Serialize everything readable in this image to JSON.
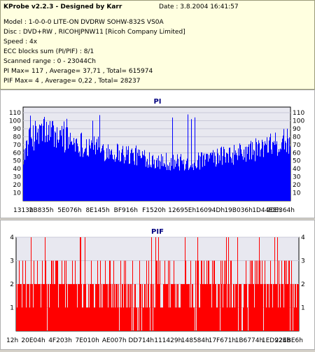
{
  "header": {
    "title": "KProbe v2.2.3 - Designed by Karr",
    "date": "Date : 3.8.2004 16:41:57"
  },
  "info": {
    "model": "Model : 1-0-0-0 LITE-ON DVDRW SOHW-832S  VS0A",
    "disc": "Disc : DVD+RW , RICOHJPNW11 [Ricoh Company Limited]",
    "speed": "Speed : 4x",
    "ecc": "ECC blocks sum (PI/PIF) : 8/1",
    "range": "Scanned range : 0 - 23044Ch",
    "pi": "PI Max= 117 , Average= 37,71 , Total= 615974",
    "pif": "PIF Max= 4 , Average= 0,22 , Total= 28237"
  },
  "colors": {
    "pi": "#0000ff",
    "pif": "#ff0000",
    "plot_bg": "#e8e8f0",
    "title_text": "#000080"
  },
  "chart_data": [
    {
      "type": "bar",
      "title": "PI",
      "ylim": [
        0,
        117
      ],
      "yticks": [
        10,
        20,
        30,
        40,
        50,
        60,
        70,
        80,
        90,
        100,
        110
      ],
      "xticks": [
        "1313h",
        "2B835h",
        "5E076h",
        "8E145h",
        "BF916h",
        "F1520h",
        "12695Eh",
        "16094Dh",
        "19B036h",
        "1D44EEh",
        "20E364h"
      ],
      "profile_x": [
        0,
        0.03,
        0.08,
        0.15,
        0.25,
        0.35,
        0.45,
        0.55,
        0.62,
        0.7,
        0.8,
        0.88,
        0.95,
        1.0
      ],
      "profile_y": [
        60,
        82,
        90,
        80,
        70,
        62,
        56,
        50,
        48,
        54,
        60,
        66,
        72,
        78
      ],
      "spike_to": 110,
      "grid": true
    },
    {
      "type": "bar",
      "title": "PIF",
      "ylim": [
        0,
        4
      ],
      "yticks": [
        1,
        2,
        3,
        4
      ],
      "xticks": [
        "12h",
        "20E04h",
        "4F203h",
        "7E010h",
        "AE007h",
        "DD714h",
        "111429h",
        "148584h",
        "17F671h",
        "1B6774h",
        "1ED92Eh",
        "224BE6h"
      ],
      "levels": [
        0,
        1,
        2,
        3,
        4
      ],
      "level_share": [
        0.05,
        0.18,
        0.52,
        0.2,
        0.05
      ],
      "grid": true
    }
  ]
}
